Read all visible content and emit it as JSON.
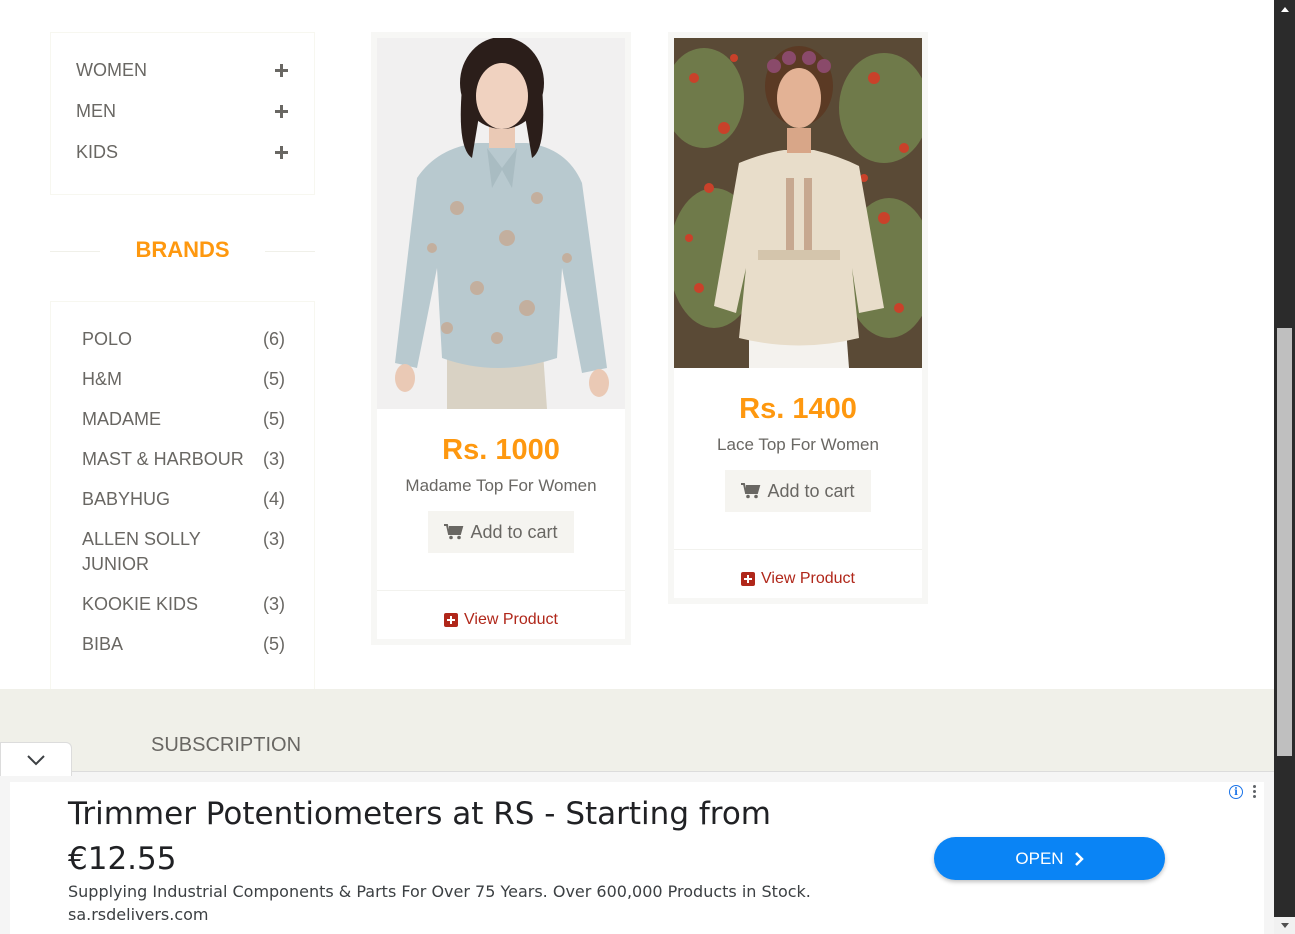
{
  "categories": [
    {
      "label": "WOMEN"
    },
    {
      "label": "MEN"
    },
    {
      "label": "KIDS"
    }
  ],
  "brands_heading": "BRANDS",
  "brands": [
    {
      "name": "POLO",
      "count": "(6)"
    },
    {
      "name": "H&M",
      "count": "(5)"
    },
    {
      "name": "MADAME",
      "count": "(5)"
    },
    {
      "name": "MAST & HARBOUR",
      "count": "(3)"
    },
    {
      "name": "BABYHUG",
      "count": "(4)"
    },
    {
      "name": "ALLEN SOLLY JUNIOR",
      "count": "(3)"
    },
    {
      "name": "KOOKIE KIDS",
      "count": "(3)"
    },
    {
      "name": "BIBA",
      "count": "(5)"
    }
  ],
  "products": [
    {
      "price": "Rs. 1000",
      "name": "Madame Top For Women",
      "cart_label": "Add to cart",
      "view_label": "View Product"
    },
    {
      "price": "Rs. 1400",
      "name": "Lace Top For Women",
      "cart_label": "Add to cart",
      "view_label": "View Product"
    }
  ],
  "footer": {
    "subscription_title": "SUBSCRIPTION"
  },
  "ad": {
    "headline": "Trimmer Potentiometers at RS - Starting from €12.55",
    "description": "Supplying Industrial Components & Parts For Over 75 Years. Over 600,000 Products in Stock.",
    "url": "sa.rsdelivers.com",
    "open_label": "OPEN"
  },
  "colors": {
    "accent": "#fe980f",
    "link": "#b0271a",
    "text": "#696763",
    "ad_button": "#0a84f5"
  }
}
